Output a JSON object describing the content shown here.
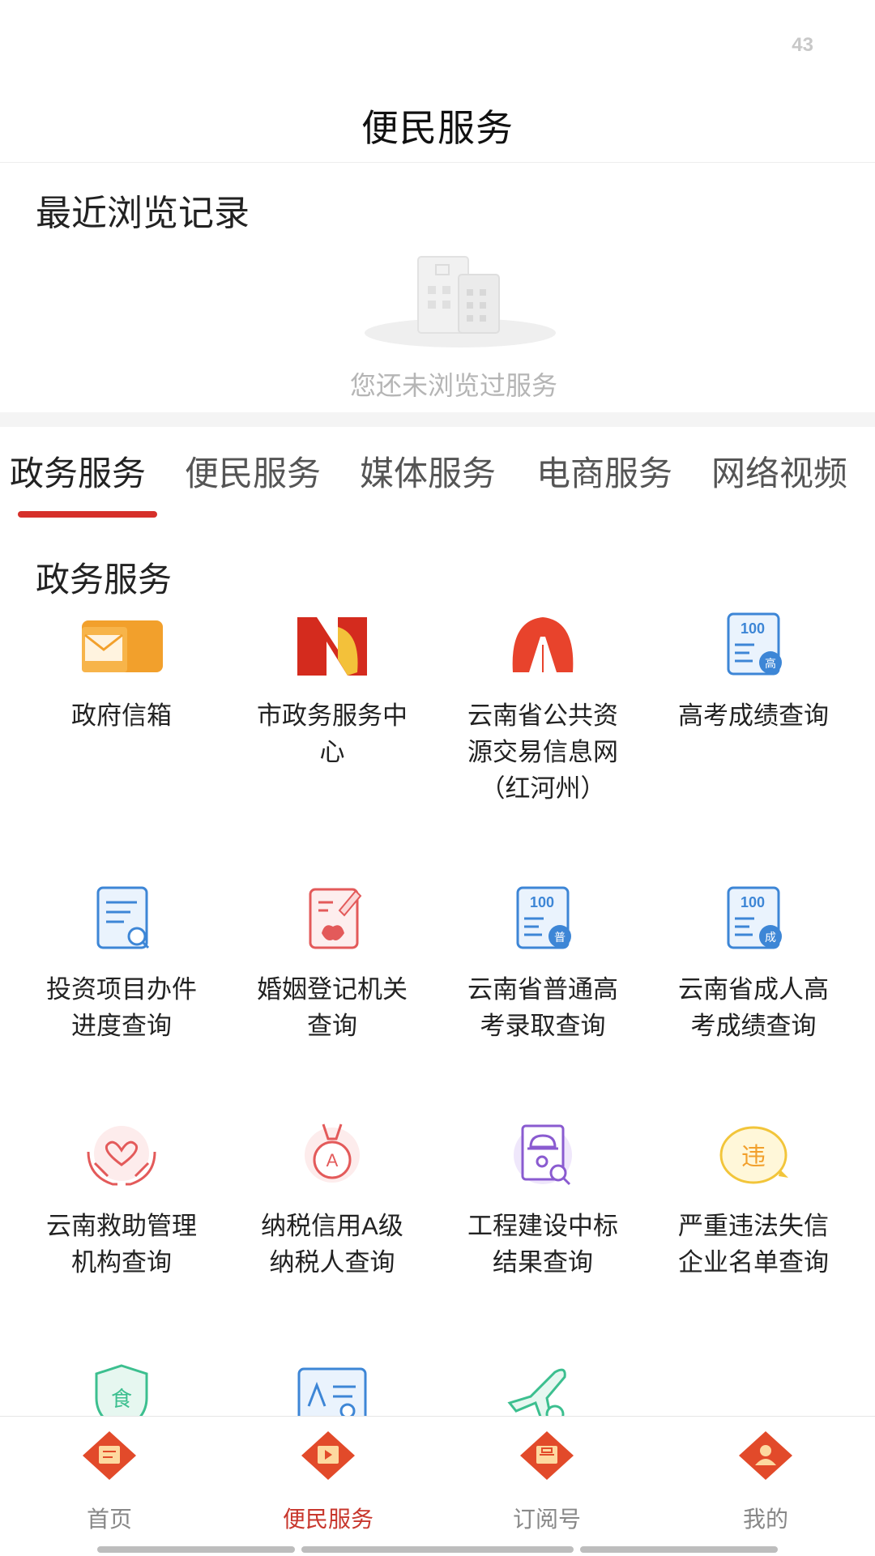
{
  "status_bar": {
    "number": "43"
  },
  "header": {
    "title": "便民服务"
  },
  "recent": {
    "title": "最近浏览记录",
    "empty_text": "您还未浏览过服务"
  },
  "tabs": [
    {
      "label": "政务服务",
      "active": true
    },
    {
      "label": "便民服务",
      "active": false
    },
    {
      "label": "媒体服务",
      "active": false
    },
    {
      "label": "电商服务",
      "active": false
    },
    {
      "label": "网络视频",
      "active": false
    }
  ],
  "section": {
    "title": "政务服务"
  },
  "services": [
    {
      "label": "政府信箱",
      "icon": "mailbox-icon"
    },
    {
      "label": "市政务服务中心",
      "icon": "service-center-logo-icon"
    },
    {
      "label": "云南省公共资源交易信息网（红河州）",
      "icon": "trade-network-logo-icon"
    },
    {
      "label": "高考成绩查询",
      "icon": "score-gao-icon",
      "badge": "100",
      "badge_char": "高"
    },
    {
      "label": "投资项目办件进度查询",
      "icon": "document-search-icon"
    },
    {
      "label": "婚姻登记机关查询",
      "icon": "marriage-registry-icon"
    },
    {
      "label": "云南省普通高考录取查询",
      "icon": "score-pu-icon",
      "badge": "100",
      "badge_char": "普"
    },
    {
      "label": "云南省成人高考成绩查询",
      "icon": "score-cheng-icon",
      "badge": "100",
      "badge_char": "成"
    },
    {
      "label": "云南救助管理机构查询",
      "icon": "helping-hands-icon"
    },
    {
      "label": "纳税信用A级纳税人查询",
      "icon": "medal-a-icon",
      "badge_char": "A"
    },
    {
      "label": "工程建设中标结果查询",
      "icon": "construction-search-icon"
    },
    {
      "label": "严重违法失信企业名单查询",
      "icon": "violation-badge-icon",
      "badge_char": "违"
    },
    {
      "label": "",
      "icon": "food-shield-icon",
      "badge_char": "食"
    },
    {
      "label": "",
      "icon": "id-card-icon"
    },
    {
      "label": "",
      "icon": "airplane-icon"
    }
  ],
  "bottom_nav": [
    {
      "label": "首页",
      "active": false,
      "icon": "home-news-icon"
    },
    {
      "label": "便民服务",
      "active": true,
      "icon": "video-service-icon"
    },
    {
      "label": "订阅号",
      "active": false,
      "icon": "subscription-icon"
    },
    {
      "label": "我的",
      "active": false,
      "icon": "profile-icon"
    }
  ],
  "colors": {
    "accent": "#d6302a",
    "nav_active": "#c8372d",
    "icon_blue": "#3d86d6",
    "icon_orange": "#f2a02c",
    "icon_red": "#e8432c",
    "icon_purple": "#8a5bd0",
    "icon_yellow": "#f2c53a",
    "icon_green": "#3cbf8f"
  }
}
